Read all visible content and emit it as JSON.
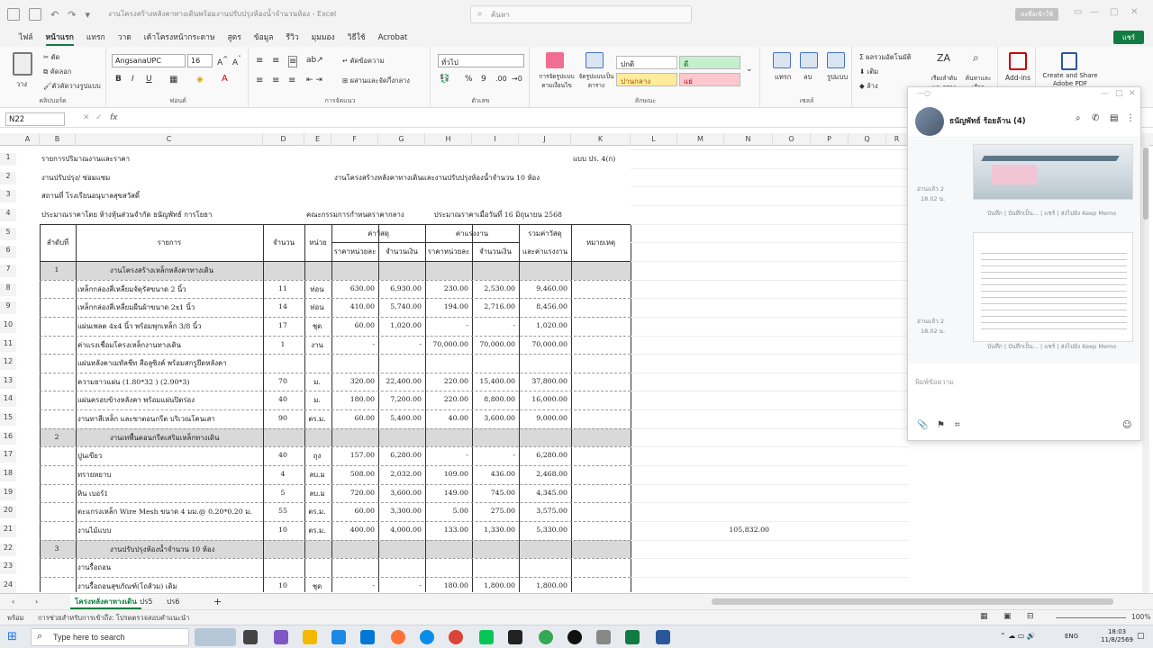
{
  "title_bar": {
    "doc_title": "งานโครงสร้างหลังคาทางเดินพร้อมงานปรับปรุงห้องน้ำจำนวนห้อง - Excel",
    "search_placeholder": "ค้นหา",
    "signin_label": "ลงชื่อเข้าใช้"
  },
  "menu_tabs": [
    "ไฟล์",
    "หน้าแรก",
    "แทรก",
    "วาด",
    "เค้าโครงหน้ากระดาษ",
    "สูตร",
    "ข้อมูล",
    "รีวิว",
    "มุมมอง",
    "วิธีใช้",
    "Acrobat"
  ],
  "share_label": "แชร์",
  "ribbon": {
    "clipboard": {
      "paste": "วาง",
      "cut": "ตัด",
      "copy": "คัดลอก",
      "format_painter": "ตัวคัดวางรูปแบบ",
      "label": "คลิปบอร์ด"
    },
    "font": {
      "name": "AngsanaUPC",
      "size": "16",
      "label": "ฟอนต์",
      "bold": "B",
      "italic": "I",
      "underline": "U"
    },
    "alignment": {
      "wrap": "ตัดข้อความ",
      "merge": "ผสานและจัดกึ่งกลาง",
      "label": "การจัดแนว"
    },
    "number": {
      "format": "ทั่วไป",
      "label": "ตัวเลข"
    },
    "styles": {
      "conditional": "การจัดรูปแบบตามเงื่อนไข",
      "format_table": "จัดรูปแบบเป็นตาราง",
      "normal": "ปกติ",
      "good": "ดี",
      "neutral": "ปานกลาง",
      "bad": "แย่",
      "label": "ลักษณะ"
    },
    "cells": {
      "insert": "แทรก",
      "delete": "ลบ",
      "format": "รูปแบบ",
      "label": "เซลล์"
    },
    "editing": {
      "autosum": "ผลรวมอัตโนมัติ",
      "fill": "เติม",
      "clear": "ล้าง",
      "sort": "เรียงลำดับและกรอง",
      "find": "ค้นหาและเลือก",
      "label": "การแก้ไข"
    },
    "addins": {
      "addins": "Add-ins",
      "adobe": "Create and Share Adobe PDF"
    }
  },
  "formula_bar": {
    "name_box": "N22",
    "fx": "fx",
    "content": ""
  },
  "columns": [
    "A",
    "B",
    "C",
    "D",
    "E",
    "F",
    "G",
    "H",
    "I",
    "J",
    "K",
    "L",
    "M",
    "N",
    "O",
    "P",
    "Q",
    "R"
  ],
  "rows": [
    "1",
    "2",
    "3",
    "4",
    "5",
    "6",
    "7",
    "8",
    "9",
    "10",
    "11",
    "12",
    "13",
    "14",
    "15",
    "16",
    "17",
    "18",
    "19",
    "20",
    "21",
    "22",
    "23",
    "24"
  ],
  "sheet": {
    "r1": {
      "title": "รายการปริมาณงานและราคา",
      "form": "แบบ ปร. 4(ก)"
    },
    "r2": {
      "label": "งานปรับปรุง/ ซ่อมแซม",
      "project": "งานโครงสร้างหลังคาทางเดินและงานปรับปรุงห้องน้ำจำนวน 10 ห้อง"
    },
    "r3": {
      "place": "สถานที่  โรงเรียนอนุบาลสุขสวัสดิ์"
    },
    "r4": {
      "estimator": "ประมาณราคาโดย ห้างหุ้นส่วนจำกัด ธนัญพัทธ์ การโยธา",
      "committee": "คณะกรรมการกำหนดราคากลาง",
      "date": "ประมาณราคาเมื่อวันที่ 16 มิถุนายน 2568"
    },
    "header": {
      "no": "ลำดับที่",
      "item": "รายการ",
      "qty": "จำนวน",
      "unit": "หน่วย",
      "material": "ค่าวัสดุ",
      "labor": "ค่าแรงงาน",
      "total_top": "รวมค่าวัสดุ",
      "total_bottom": "และค่าแรงงาน",
      "unit_price": "ราคาหน่วยละ",
      "amount": "จำนวนเงิน",
      "remark": "หมายเหตุ"
    },
    "lines": [
      {
        "row": "7",
        "no": "1",
        "item": "งานโครงสร้างเหล็กหลังคาทางเดิน",
        "section": true
      },
      {
        "row": "8",
        "item": "เหล็กกล่องสี่เหลี่ยมจัตุรัสขนาด 2 นิ้ว",
        "qty": "11",
        "unit": "ท่อน",
        "mat_price": "630.00",
        "mat_amt": "6,930.00",
        "lab_price": "230.00",
        "lab_amt": "2,530.00",
        "total": "9,460.00"
      },
      {
        "row": "9",
        "item": "เหล็กกล่องสี่เหลี่ยมผืนผ้าขนาด 2x1 นิ้ว",
        "qty": "14",
        "unit": "ท่อน",
        "mat_price": "410.00",
        "mat_amt": "5,740.00",
        "lab_price": "194.00",
        "lab_amt": "2,716.00",
        "total": "8,456.00"
      },
      {
        "row": "10",
        "item": "แผ่นเพลต 4x4 นิ้ว พร้อมพุกเหล็ก 3/8 นิ้ว",
        "qty": "17",
        "unit": "ชุด",
        "mat_price": "60.00",
        "mat_amt": "1,020.00",
        "lab_price": "-",
        "lab_amt": "-",
        "total": "1,020.00"
      },
      {
        "row": "11",
        "item": "ค่าแรงเชื่อมโครงเหล็กงานทางเดิน",
        "qty": "1",
        "unit": "งาน",
        "mat_price": "-",
        "mat_amt": "-",
        "lab_price": "70,000.00",
        "lab_amt": "70,000.00",
        "total": "70,000.00"
      },
      {
        "row": "12",
        "item": "แผ่นหลังคาเมทัลชีท สีอลูซิงค์ พร้อมสกรูยึดหลังคา"
      },
      {
        "row": "13",
        "item": "ความยาวแผ่น (1.80*32 ) (2.90*3)",
        "qty": "70",
        "unit": "ม.",
        "mat_price": "320.00",
        "mat_amt": "22,400.00",
        "lab_price": "220.00",
        "lab_amt": "15,400.00",
        "total": "37,800.00"
      },
      {
        "row": "14",
        "item": "แผ่นครอบข้างหลังคา พร้อมแผ่นปิดร่อง",
        "qty": "40",
        "unit": "ม.",
        "mat_price": "180.00",
        "mat_amt": "7,200.00",
        "lab_price": "220.00",
        "lab_amt": "8,800.00",
        "total": "16,000.00"
      },
      {
        "row": "15",
        "item": "งานทาสีเหล็ก และขาตอนกรีต บริเวณโคนเสา",
        "qty": "90",
        "unit": "ตร.ม.",
        "mat_price": "60.00",
        "mat_amt": "5,400.00",
        "lab_price": "40.00",
        "lab_amt": "3,600.00",
        "total": "9,000.00"
      },
      {
        "row": "16",
        "no": "2",
        "item": "งานเทพื้นคอนกรีตเสริมเหล็กทางเดิน",
        "section": true
      },
      {
        "row": "17",
        "item": "ปูนเขียว",
        "qty": "40",
        "unit": "ถุง",
        "mat_price": "157.00",
        "mat_amt": "6,280.00",
        "lab_price": "-",
        "lab_amt": "-",
        "total": "6,280.00"
      },
      {
        "row": "18",
        "item": "ทรายหยาบ",
        "qty": "4",
        "unit": "ลบ.ม",
        "mat_price": "508.00",
        "mat_amt": "2,032.00",
        "lab_price": "109.00",
        "lab_amt": "436.00",
        "total": "2,468.00"
      },
      {
        "row": "19",
        "item": "หิน เบอร์1",
        "qty": "5",
        "unit": "ลบ.ม",
        "mat_price": "720.00",
        "mat_amt": "3,600.00",
        "lab_price": "149.00",
        "lab_amt": "745.00",
        "total": "4,345.00"
      },
      {
        "row": "20",
        "item": "ตะแกรงเหล็ก Wire Mesh ขนาด 4 มม.@ 0.20*0.20 ม.",
        "qty": "55",
        "unit": "ตร.ม.",
        "mat_price": "60.00",
        "mat_amt": "3,300.00",
        "lab_price": "5.00",
        "lab_amt": "275.00",
        "total": "3,575.00"
      },
      {
        "row": "21",
        "item": "งานไม้แบบ",
        "qty": "10",
        "unit": "ตร.ม.",
        "mat_price": "400.00",
        "mat_amt": "4,000.00",
        "lab_price": "133.00",
        "lab_amt": "1,330.00",
        "total": "5,330.00",
        "extra": "105,832.00"
      },
      {
        "row": "22",
        "no": "3",
        "item": "งานปรับปรุงห้องน้ำจำนวน 10 ห้อง",
        "section": true
      },
      {
        "row": "23",
        "item": "งานรื้อถอน"
      },
      {
        "row": "24",
        "item": "งานรื้อถอนสุขภัณฑ์(โถส้วม) เดิม",
        "qty": "10",
        "unit": "ชุด",
        "mat_price": "-",
        "mat_amt": "-",
        "lab_price": "180.00",
        "lab_amt": "1,800.00",
        "total": "1,800.00"
      }
    ]
  },
  "sheet_tabs": [
    "โครงหลังคาทางเดิน",
    "ปร5",
    "ปร6"
  ],
  "status": {
    "ready": "พร้อม",
    "accessibility": "การช่วยสำหรับการเข้าถึง: โปรดตรวจสอบคำแนะนำ",
    "zoom": "100%"
  },
  "taskbar": {
    "search_placeholder": "Type here to search",
    "lang": "ENG",
    "time": "18:03",
    "date": "11/8/2569"
  },
  "chat": {
    "contact": "ธนัญพัทธ์ ร้อยล้าน (4)",
    "read1": "อ่านแล้ว 2",
    "time1": "18.02 น.",
    "read2": "อ่านแล้ว 2",
    "time2": "18.02 น.",
    "actions": "บันทึก  |  บันทึกเป็น...  |  แชร์  |  ส่งไปยัง Keep Memo",
    "input_placeholder": "พิมพ์ข้อความ"
  },
  "colors": {
    "excel_green": "#107c41",
    "section_band": "#d9d9d9",
    "good_fill": "#c6efce",
    "neutral_fill": "#ffeb9c",
    "bad_fill": "#ffc7ce"
  }
}
